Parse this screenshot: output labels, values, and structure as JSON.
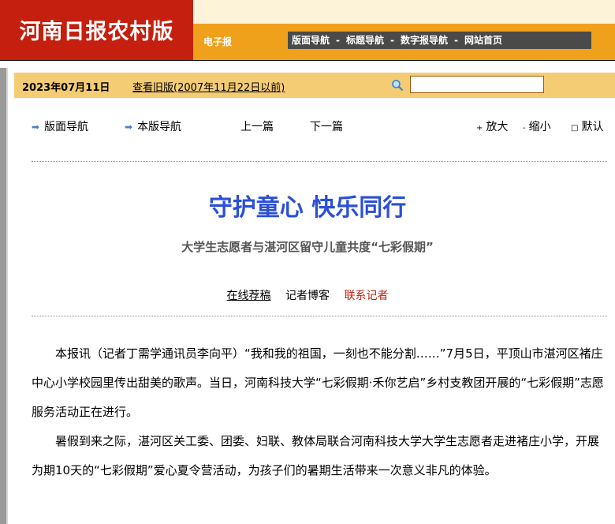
{
  "banner": {
    "title": "河南日报农村版",
    "subtitle": "电子报",
    "nav": [
      "版面导航",
      "标题导航",
      "数字报导航",
      "网站首页"
    ],
    "separator": "-"
  },
  "datebar": {
    "date": "2023年07月11日",
    "old_link": "查看旧版(2007年11月22日以前)",
    "search_value": ""
  },
  "nav": {
    "page_nav": "版面导航",
    "edition_nav": "本版导航",
    "prev": "上一篇",
    "next": "下一篇",
    "zoom_in": "放大",
    "zoom_out": "缩小",
    "default": "默认",
    "zoom_in_glyph": "+",
    "zoom_out_glyph": "-",
    "default_glyph": "□"
  },
  "article": {
    "title": "守护童心 快乐同行",
    "subtitle": "大学生志愿者与湛河区留守儿童共度“七彩假期”",
    "links": {
      "online": "在线荐稿",
      "blog": "记者博客",
      "contact": "联系记者"
    },
    "paragraphs": [
      "本报讯（记者丁需学通讯员李向平）“我和我的祖国，一刻也不能分割……”7月5日，平顶山市湛河区褚庄中心小学校园里传出甜美的歌声。当日，河南科技大学“七彩假期·禾你艺启”乡村支教团开展的“七彩假期”志愿服务活动正在进行。",
      "暑假到来之际，湛河区关工委、团委、妇联、教体局联合河南科技大学大学生志愿者走进褚庄小学，开展为期10天的“七彩假期”爱心夏令营活动，为孩子们的暑期生活带来一次意义非凡的体验。"
    ]
  },
  "colors": {
    "banner_red": "#c5200f",
    "banner_orange": "#f0a11c",
    "datebar": "#f4cc74",
    "headline_blue": "#2b4fd8",
    "contact_red": "#c5200f"
  }
}
